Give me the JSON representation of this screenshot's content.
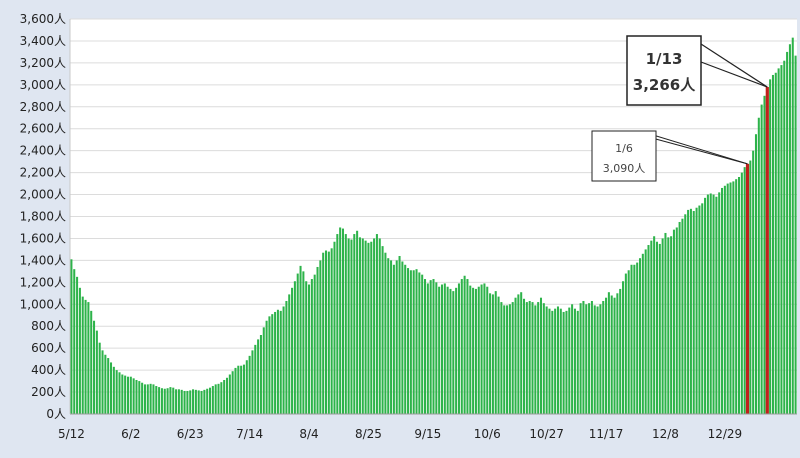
{
  "chart_data": {
    "type": "bar",
    "x_start": "5/12",
    "x_ticks": [
      "5/12",
      "6/2",
      "6/23",
      "7/14",
      "8/4",
      "8/25",
      "9/15",
      "10/6",
      "10/27",
      "11/17",
      "12/8",
      "12/29"
    ],
    "y_ticks": [
      "0人",
      "200人",
      "400人",
      "600人",
      "800人",
      "1,000人",
      "1,200人",
      "1,400人",
      "1,600人",
      "1,800人",
      "2,000人",
      "2,200人",
      "2,400人",
      "2,600人",
      "2,800人",
      "3,000人",
      "3,200人",
      "3,400人",
      "3,600人"
    ],
    "ylim": [
      0,
      3600
    ],
    "unit": "人",
    "bar_color": "#2db34a",
    "highlight_color": "#c0211b",
    "grid": true,
    "highlights": [
      {
        "index": 239,
        "date": "1/6",
        "value": 3090
      },
      {
        "index": 246,
        "date": "1/13",
        "value": 3266
      }
    ],
    "annotations": [
      {
        "date": "1/13",
        "value_text": "3,266人",
        "target_index": 246
      },
      {
        "date": "1/6",
        "value_text": "3,090人",
        "target_index": 239
      }
    ],
    "values": [
      1410,
      1320,
      1250,
      1150,
      1070,
      1040,
      1020,
      940,
      850,
      760,
      650,
      580,
      540,
      510,
      470,
      430,
      400,
      380,
      360,
      350,
      340,
      340,
      325,
      310,
      300,
      285,
      270,
      270,
      275,
      270,
      255,
      245,
      235,
      230,
      235,
      245,
      240,
      225,
      225,
      220,
      210,
      210,
      215,
      225,
      220,
      215,
      210,
      220,
      230,
      240,
      255,
      270,
      275,
      290,
      310,
      330,
      360,
      390,
      420,
      440,
      440,
      450,
      490,
      530,
      580,
      630,
      680,
      720,
      790,
      850,
      890,
      910,
      930,
      950,
      940,
      980,
      1030,
      1090,
      1150,
      1210,
      1280,
      1350,
      1300,
      1210,
      1180,
      1230,
      1270,
      1340,
      1400,
      1470,
      1490,
      1480,
      1510,
      1570,
      1640,
      1700,
      1690,
      1640,
      1600,
      1590,
      1640,
      1670,
      1610,
      1600,
      1580,
      1560,
      1570,
      1600,
      1640,
      1600,
      1530,
      1470,
      1420,
      1400,
      1360,
      1400,
      1440,
      1390,
      1360,
      1330,
      1310,
      1310,
      1320,
      1290,
      1270,
      1230,
      1190,
      1220,
      1230,
      1200,
      1160,
      1180,
      1190,
      1160,
      1140,
      1120,
      1150,
      1190,
      1230,
      1260,
      1230,
      1170,
      1150,
      1140,
      1160,
      1180,
      1190,
      1160,
      1100,
      1090,
      1120,
      1070,
      1020,
      990,
      990,
      1000,
      1020,
      1060,
      1090,
      1110,
      1050,
      1020,
      1030,
      1020,
      990,
      1020,
      1060,
      1010,
      980,
      960,
      940,
      960,
      980,
      960,
      930,
      940,
      970,
      1000,
      960,
      940,
      1010,
      1030,
      1000,
      1010,
      1030,
      990,
      980,
      1000,
      1030,
      1060,
      1110,
      1080,
      1060,
      1100,
      1140,
      1210,
      1280,
      1310,
      1360,
      1360,
      1380,
      1420,
      1460,
      1500,
      1540,
      1580,
      1620,
      1570,
      1550,
      1600,
      1650,
      1610,
      1620,
      1680,
      1700,
      1750,
      1780,
      1820,
      1860,
      1870,
      1850,
      1880,
      1900,
      1920,
      1970,
      2000,
      2010,
      2000,
      1980,
      2020,
      2060,
      2080,
      2100,
      2110,
      2120,
      2140,
      2160,
      2200,
      2250,
      2280,
      2310,
      2400,
      2550,
      2700,
      2820,
      2900,
      2980,
      3050,
      3090,
      3110,
      3150,
      3180,
      3220,
      3300,
      3370,
      3430,
      3266
    ]
  }
}
